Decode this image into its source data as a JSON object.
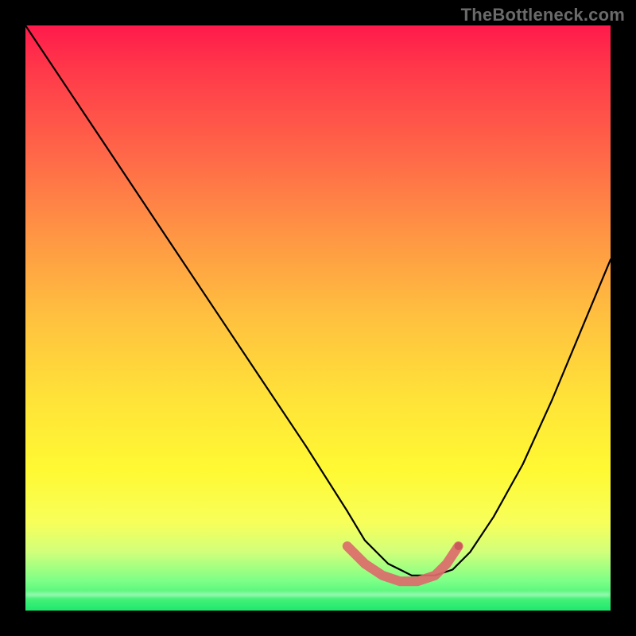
{
  "watermark": {
    "text": "TheBottleneck.com"
  },
  "chart_data": {
    "type": "line",
    "title": "",
    "xlabel": "",
    "ylabel": "",
    "xlim": [
      0,
      100
    ],
    "ylim": [
      0,
      100
    ],
    "grid": false,
    "legend": false,
    "background_gradient": {
      "direction": "vertical",
      "stops": [
        {
          "pos": 0.0,
          "color": "#ff1a4b"
        },
        {
          "pos": 0.5,
          "color": "#ffc13f"
        },
        {
          "pos": 0.8,
          "color": "#fff933"
        },
        {
          "pos": 0.95,
          "color": "#7bff87"
        },
        {
          "pos": 1.0,
          "color": "#1fe86e"
        }
      ]
    },
    "series": [
      {
        "name": "curve",
        "color": "#000000",
        "x": [
          0,
          8,
          16,
          24,
          32,
          40,
          48,
          55,
          58,
          62,
          66,
          70,
          73,
          76,
          80,
          85,
          90,
          95,
          100
        ],
        "y": [
          100,
          88,
          76,
          64,
          52,
          40,
          28,
          17,
          12,
          8,
          6,
          6,
          7,
          10,
          16,
          25,
          36,
          48,
          60
        ]
      },
      {
        "name": "bottom-marker",
        "color": "#e57373",
        "x": [
          55,
          58,
          61,
          64,
          67,
          70,
          72,
          74
        ],
        "y": [
          11,
          8,
          6,
          5,
          5,
          6,
          8,
          11
        ]
      }
    ]
  }
}
